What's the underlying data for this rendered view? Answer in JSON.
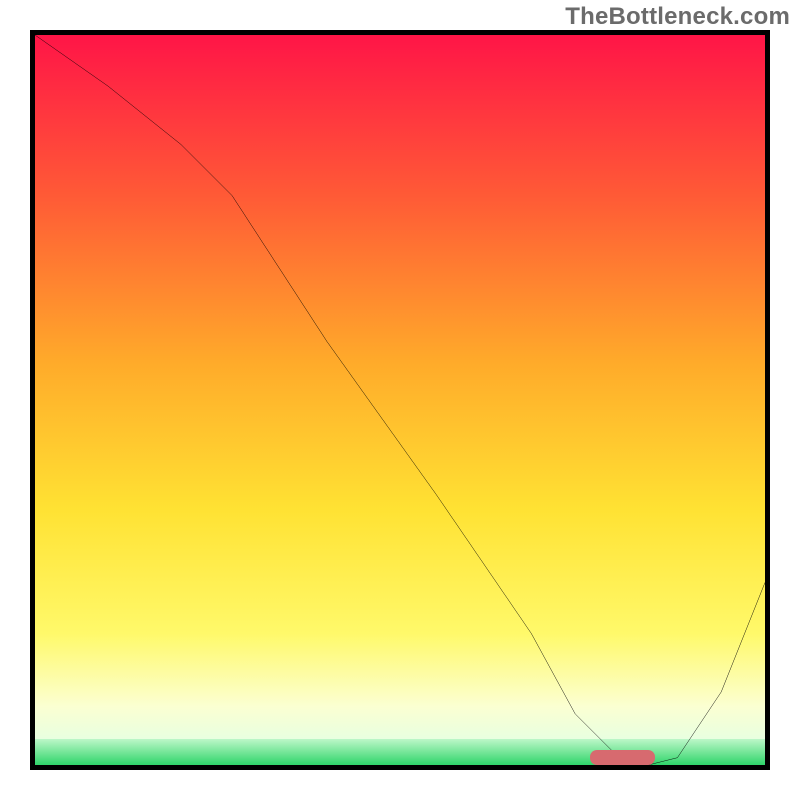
{
  "watermark": "TheBottleneck.com",
  "chart_data": {
    "type": "line",
    "title": "",
    "xlabel": "",
    "ylabel": "",
    "xlim": [
      0,
      100
    ],
    "ylim": [
      0,
      100
    ],
    "grid": false,
    "legend": false,
    "background": {
      "gradient_stops": [
        {
          "pct": 0,
          "color": "#ff1547"
        },
        {
          "pct": 22,
          "color": "#ff5a36"
        },
        {
          "pct": 45,
          "color": "#ffab2a"
        },
        {
          "pct": 65,
          "color": "#ffe233"
        },
        {
          "pct": 82,
          "color": "#fff96a"
        },
        {
          "pct": 92,
          "color": "#fbffd2"
        },
        {
          "pct": 96.5,
          "color": "#e8ffe0"
        },
        {
          "pct": 100,
          "color": "#2fd56a"
        }
      ],
      "green_band_height_pct": 3.5
    },
    "series": [
      {
        "name": "bottleneck-curve",
        "color": "#000000",
        "x": [
          0,
          10,
          20,
          27,
          40,
          55,
          68,
          74,
          80,
          84,
          88,
          94,
          100
        ],
        "values": [
          100,
          93,
          85,
          78,
          58,
          37,
          18,
          7,
          1,
          0,
          1,
          10,
          25
        ]
      }
    ],
    "marker": {
      "name": "optimal-range",
      "color": "#d76a6f",
      "x_start_pct": 76,
      "x_end_pct": 85,
      "y_pct": 0,
      "height_pct": 2
    }
  }
}
